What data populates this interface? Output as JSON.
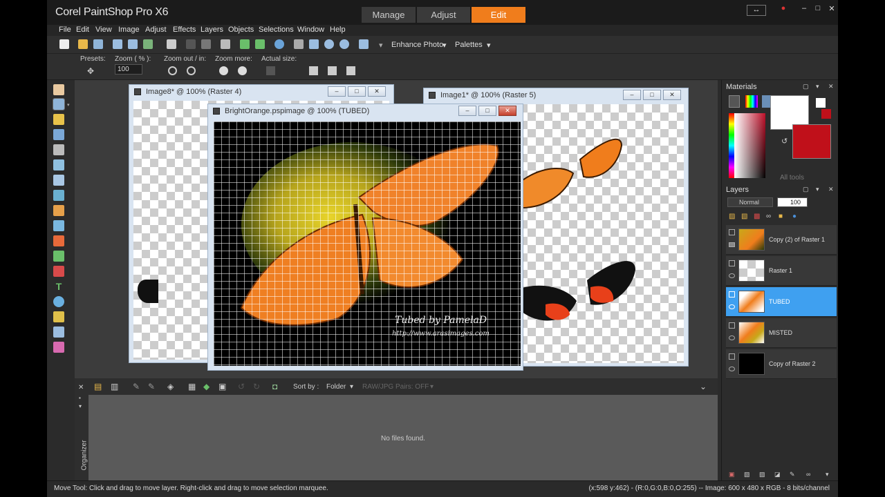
{
  "app": {
    "title": "Corel PaintShop Pro X6",
    "modes": [
      "Manage",
      "Adjust",
      "Edit"
    ],
    "active_mode": "Edit"
  },
  "menu": [
    "File",
    "Edit",
    "View",
    "Image",
    "Adjust",
    "Effects",
    "Layers",
    "Objects",
    "Selections",
    "Window",
    "Help"
  ],
  "toolbar": {
    "enhance_photo": "Enhance Photo",
    "palettes": "Palettes"
  },
  "options": {
    "presets_label": "Presets:",
    "zoom_label": "Zoom ( % ):",
    "zoom_value": "100",
    "zoom_out_in_label": "Zoom out / in:",
    "zoom_more_label": "Zoom more:",
    "actual_size_label": "Actual size:"
  },
  "documents": {
    "image8_title": "Image8* @ 100% (Raster 4)",
    "image1_title": "Image1* @ 100% (Raster 5)",
    "brightorange_title": "BrightOrange.pspimage @ 100% (TUBED)",
    "watermark_line1": "Tubed by PamelaD",
    "watermark_line2": "http://www.arasimages.com"
  },
  "organizer": {
    "sort_by_label": "Sort by :",
    "sort_value": "Folder",
    "raw_pairs": "RAW/JPG Pairs: OFF",
    "empty_message": "No files found.",
    "side_label": "Organizer"
  },
  "materials": {
    "title": "Materials",
    "all_tools": "All tools",
    "foreground_color": "#ffffff",
    "background_color": "#c0101a"
  },
  "layers": {
    "title": "Layers",
    "blend_mode": "Normal",
    "opacity": "100",
    "items": [
      {
        "name": "Copy (2) of Raster 1",
        "active": false
      },
      {
        "name": "Raster 1",
        "active": false
      },
      {
        "name": "TUBED",
        "active": true
      },
      {
        "name": "MISTED",
        "active": false
      },
      {
        "name": "Copy of Raster 2",
        "active": false
      }
    ]
  },
  "status": {
    "left": "Move Tool: Click and drag to move layer. Right-click and drag to move selection marquee.",
    "right": "(x:598 y:462) - (R:0,G:0,B:0,O:255) -- Image:  600 x 480 x RGB - 8 bits/channel"
  },
  "colors": {
    "accent": "#f07d1c",
    "selection": "#3fa0f0"
  }
}
